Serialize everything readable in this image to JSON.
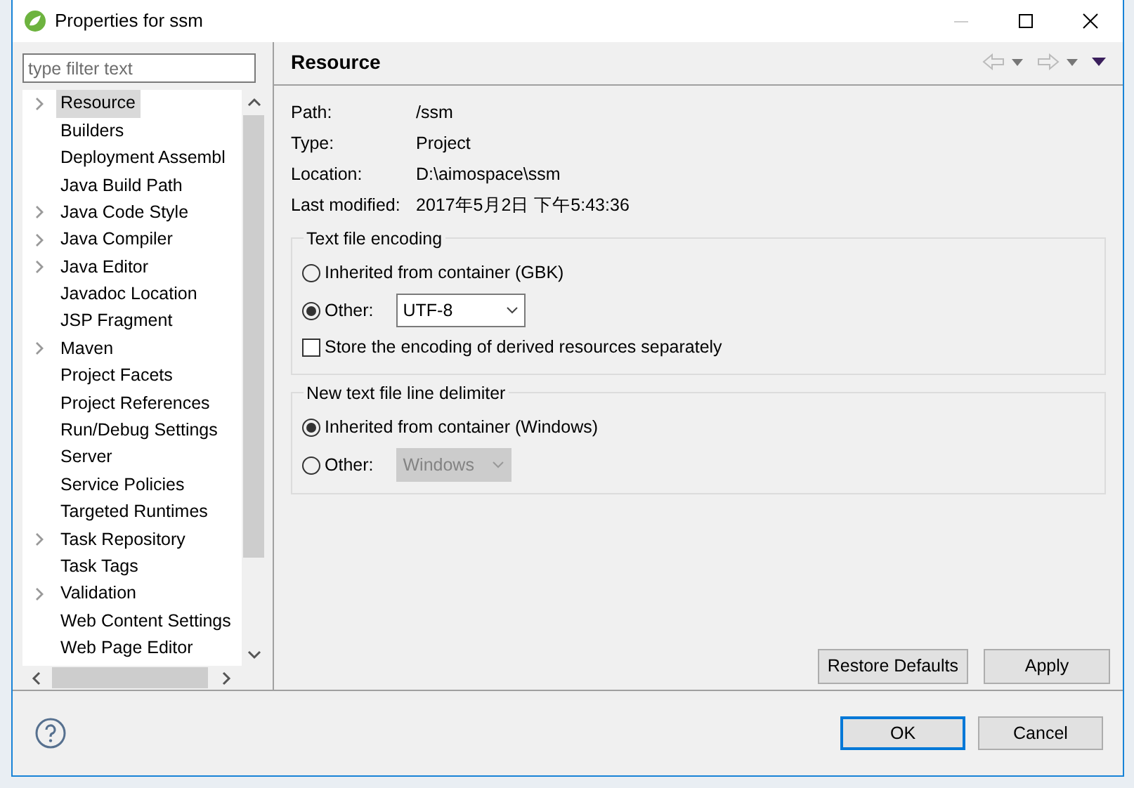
{
  "window": {
    "title": "Properties for ssm"
  },
  "filter": {
    "placeholder": "type filter text"
  },
  "tree": {
    "items": [
      {
        "label": "Resource",
        "expandable": true,
        "selected": true
      },
      {
        "label": "Builders",
        "expandable": false,
        "selected": false
      },
      {
        "label": "Deployment Assembl",
        "expandable": false,
        "selected": false
      },
      {
        "label": "Java Build Path",
        "expandable": false,
        "selected": false
      },
      {
        "label": "Java Code Style",
        "expandable": true,
        "selected": false
      },
      {
        "label": "Java Compiler",
        "expandable": true,
        "selected": false
      },
      {
        "label": "Java Editor",
        "expandable": true,
        "selected": false
      },
      {
        "label": "Javadoc Location",
        "expandable": false,
        "selected": false
      },
      {
        "label": "JSP Fragment",
        "expandable": false,
        "selected": false
      },
      {
        "label": "Maven",
        "expandable": true,
        "selected": false
      },
      {
        "label": "Project Facets",
        "expandable": false,
        "selected": false
      },
      {
        "label": "Project References",
        "expandable": false,
        "selected": false
      },
      {
        "label": "Run/Debug Settings",
        "expandable": false,
        "selected": false
      },
      {
        "label": "Server",
        "expandable": false,
        "selected": false
      },
      {
        "label": "Service Policies",
        "expandable": false,
        "selected": false
      },
      {
        "label": "Targeted Runtimes",
        "expandable": false,
        "selected": false
      },
      {
        "label": "Task Repository",
        "expandable": true,
        "selected": false
      },
      {
        "label": "Task Tags",
        "expandable": false,
        "selected": false
      },
      {
        "label": "Validation",
        "expandable": true,
        "selected": false
      },
      {
        "label": "Web Content Settings",
        "expandable": false,
        "selected": false
      },
      {
        "label": "Web Page Editor",
        "expandable": false,
        "selected": false
      }
    ]
  },
  "page": {
    "title": "Resource",
    "properties": [
      {
        "label": "Path:",
        "value": "/ssm"
      },
      {
        "label": "Type:",
        "value": "Project"
      },
      {
        "label": "Location:",
        "value": "D:\\aimospace\\ssm"
      },
      {
        "label": "Last modified:",
        "value": "2017年5月2日 下午5:43:36"
      }
    ],
    "groups": [
      {
        "title": "Text file encoding",
        "options": [
          {
            "kind": "radio",
            "label": "Inherited from container (GBK)",
            "selected": false
          },
          {
            "kind": "radio-combo",
            "label": "Other:",
            "selected": true,
            "combo": {
              "value": "UTF-8",
              "disabled": false
            }
          },
          {
            "kind": "checkbox",
            "label": "Store the encoding of derived resources separately",
            "checked": false
          }
        ]
      },
      {
        "title": "New text file line delimiter",
        "options": [
          {
            "kind": "radio",
            "label": "Inherited from container (Windows)",
            "selected": true
          },
          {
            "kind": "radio-combo",
            "label": "Other:",
            "selected": false,
            "combo": {
              "value": "Windows",
              "disabled": true
            }
          }
        ]
      }
    ],
    "buttons": [
      "Restore Defaults",
      "Apply"
    ]
  },
  "footer": {
    "buttons": [
      {
        "label": "OK",
        "default": true
      },
      {
        "label": "Cancel",
        "default": false
      }
    ]
  }
}
